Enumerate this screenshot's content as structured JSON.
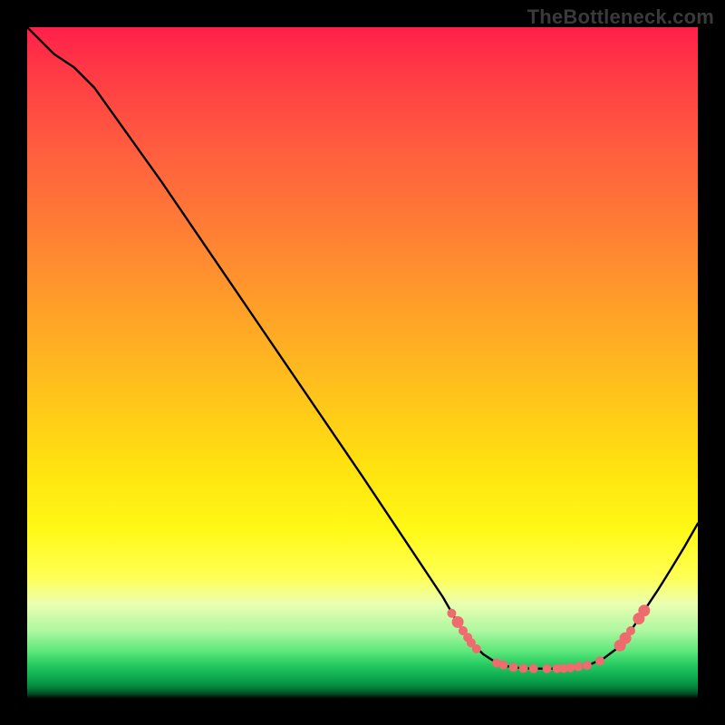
{
  "watermark": "TheBottleneck.com",
  "chart_data": {
    "type": "line",
    "title": "",
    "xlabel": "",
    "ylabel": "",
    "xlim": [
      0,
      100
    ],
    "ylim": [
      0,
      100
    ],
    "grid": false,
    "curve": {
      "name": "bottleneck-curve",
      "color": "#000000",
      "points": [
        {
          "x": 0,
          "y": 100
        },
        {
          "x": 4,
          "y": 96
        },
        {
          "x": 7,
          "y": 94
        },
        {
          "x": 10,
          "y": 91
        },
        {
          "x": 20,
          "y": 77
        },
        {
          "x": 35,
          "y": 55
        },
        {
          "x": 50,
          "y": 33
        },
        {
          "x": 58,
          "y": 21
        },
        {
          "x": 62,
          "y": 15
        },
        {
          "x": 64,
          "y": 11.5
        },
        {
          "x": 65,
          "y": 10
        },
        {
          "x": 66,
          "y": 8.5
        },
        {
          "x": 68,
          "y": 6.5
        },
        {
          "x": 70,
          "y": 5.2
        },
        {
          "x": 72,
          "y": 4.6
        },
        {
          "x": 74,
          "y": 4.4
        },
        {
          "x": 76,
          "y": 4.35
        },
        {
          "x": 78,
          "y": 4.35
        },
        {
          "x": 80,
          "y": 4.4
        },
        {
          "x": 82,
          "y": 4.6
        },
        {
          "x": 84,
          "y": 5.0
        },
        {
          "x": 86,
          "y": 5.9
        },
        {
          "x": 88,
          "y": 7.4
        },
        {
          "x": 90,
          "y": 10
        },
        {
          "x": 92,
          "y": 13
        },
        {
          "x": 94,
          "y": 16
        },
        {
          "x": 96,
          "y": 19.2
        },
        {
          "x": 98,
          "y": 22.5
        },
        {
          "x": 100,
          "y": 26
        }
      ]
    },
    "markers": {
      "color": "#ee6b6e",
      "radius_small": 5.0,
      "radius_large": 6.5,
      "points": [
        {
          "x": 63.3,
          "y": 12.6,
          "r": "s"
        },
        {
          "x": 64.2,
          "y": 11.3,
          "r": "l"
        },
        {
          "x": 65.0,
          "y": 10.0,
          "r": "s"
        },
        {
          "x": 65.7,
          "y": 9.0,
          "r": "s"
        },
        {
          "x": 66.2,
          "y": 8.2,
          "r": "s"
        },
        {
          "x": 67.0,
          "y": 7.3,
          "r": "s"
        },
        {
          "x": 70.0,
          "y": 5.2,
          "r": "s"
        },
        {
          "x": 71.0,
          "y": 4.9,
          "r": "s"
        },
        {
          "x": 72.5,
          "y": 4.55,
          "r": "s"
        },
        {
          "x": 74.0,
          "y": 4.4,
          "r": "s"
        },
        {
          "x": 75.5,
          "y": 4.37,
          "r": "s"
        },
        {
          "x": 77.5,
          "y": 4.35,
          "r": "s"
        },
        {
          "x": 79.0,
          "y": 4.37,
          "r": "s"
        },
        {
          "x": 80.0,
          "y": 4.4,
          "r": "s"
        },
        {
          "x": 81.0,
          "y": 4.5,
          "r": "s"
        },
        {
          "x": 82.2,
          "y": 4.65,
          "r": "s"
        },
        {
          "x": 83.5,
          "y": 4.85,
          "r": "s"
        },
        {
          "x": 85.4,
          "y": 5.5,
          "r": "s"
        },
        {
          "x": 88.4,
          "y": 7.8,
          "r": "l"
        },
        {
          "x": 89.2,
          "y": 8.9,
          "r": "l"
        },
        {
          "x": 90.0,
          "y": 10.0,
          "r": "s"
        },
        {
          "x": 91.2,
          "y": 11.8,
          "r": "l"
        },
        {
          "x": 92.0,
          "y": 13.0,
          "r": "l"
        }
      ]
    }
  }
}
